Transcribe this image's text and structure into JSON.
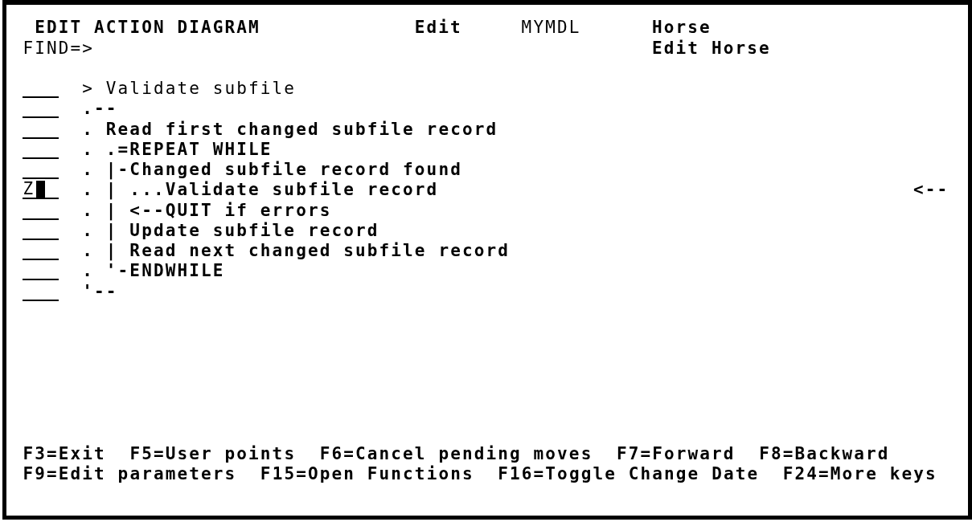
{
  "header": {
    "title": "EDIT ACTION DIAGRAM",
    "mode": "Edit",
    "model": "MYMDL",
    "file": "Horse",
    "find_prompt": "FIND=>",
    "function": "Edit Horse"
  },
  "diagram": {
    "lines": [
      {
        "kind": "heading",
        "text": "> Validate subfile",
        "cursor": false
      },
      {
        "kind": "statement",
        "text": ".--",
        "cursor": false
      },
      {
        "kind": "statement",
        "text": ". Read first changed subfile record",
        "cursor": false
      },
      {
        "kind": "statement",
        "text": ". .=REPEAT WHILE",
        "cursor": false
      },
      {
        "kind": "statement",
        "text": ". |-Changed subfile record found",
        "cursor": false
      },
      {
        "kind": "statement",
        "text": ". | ...Validate subfile record",
        "command": "Z",
        "cursor": true,
        "pointer": "<--"
      },
      {
        "kind": "statement",
        "text": ". | <--QUIT if errors",
        "cursor": false
      },
      {
        "kind": "statement",
        "text": ". | Update subfile record",
        "cursor": false
      },
      {
        "kind": "statement",
        "text": ". | Read next changed subfile record",
        "cursor": false
      },
      {
        "kind": "statement",
        "text": ". '-ENDWHILE",
        "cursor": false
      },
      {
        "kind": "statement",
        "text": "'--",
        "cursor": false
      }
    ]
  },
  "function_keys": [
    [
      "F3=Exit",
      "F5=User points",
      "F6=Cancel pending moves",
      "F7=Forward",
      "F8=Backward"
    ],
    [
      "F9=Edit parameters",
      "F15=Open Functions",
      "F16=Toggle Change Date",
      "F24=More keys"
    ]
  ]
}
